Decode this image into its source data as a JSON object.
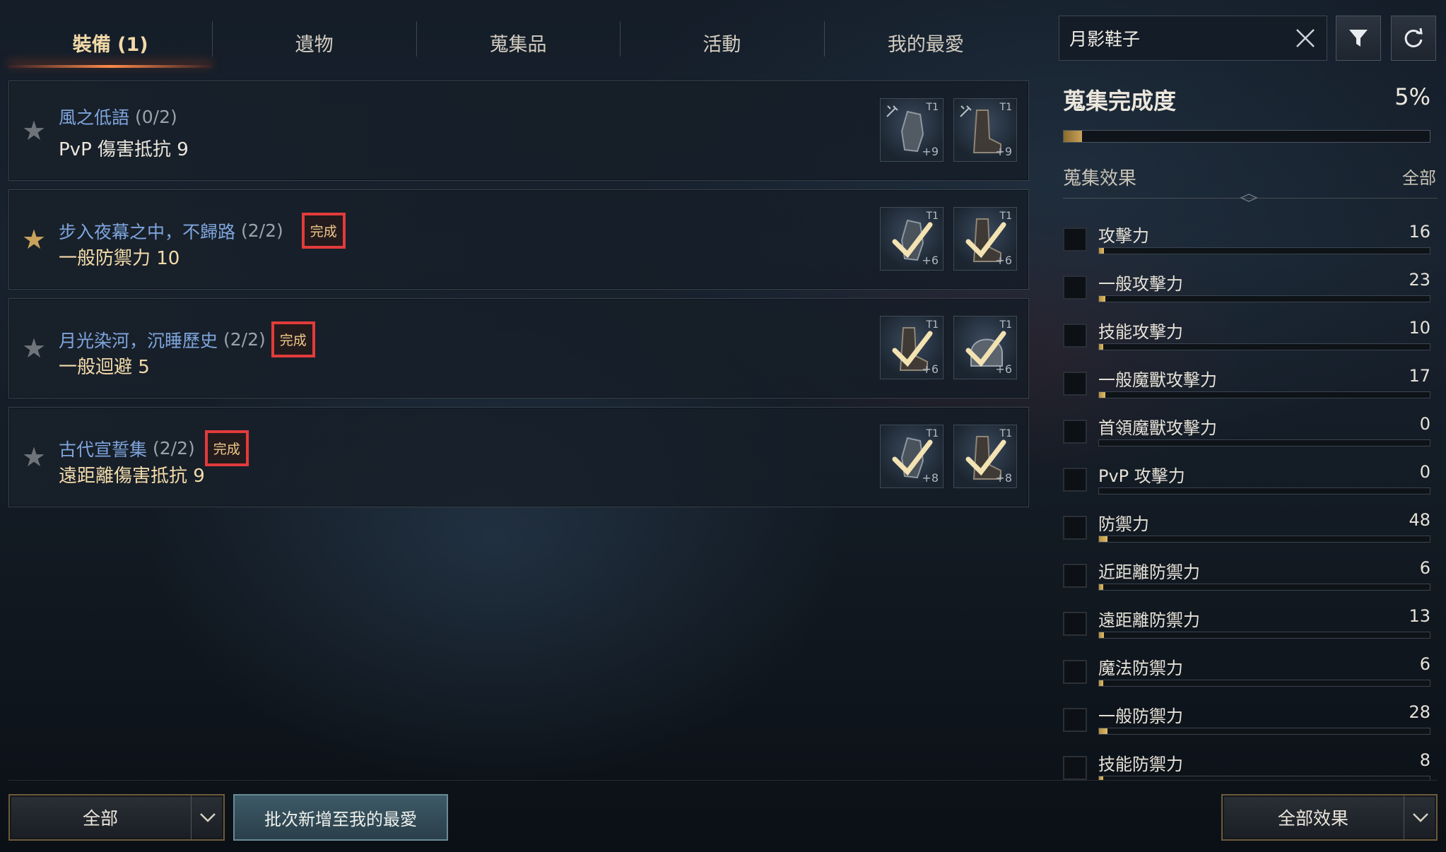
{
  "tabs": [
    {
      "label": "裝備 (1)"
    },
    {
      "label": "遺物"
    },
    {
      "label": "蒐集品"
    },
    {
      "label": "活動"
    },
    {
      "label": "我的最愛"
    }
  ],
  "search": {
    "value": "月影鞋子"
  },
  "collections": [
    {
      "name": "風之低語",
      "progress": "(0/2)",
      "stat": "PvP 傷害抵抗  9",
      "complete_label": "",
      "starred": false,
      "items": [
        {
          "tier": "T1",
          "enhance": "+9",
          "completed": false
        },
        {
          "tier": "T1",
          "enhance": "+9",
          "completed": false
        }
      ]
    },
    {
      "name": "步入夜幕之中，不歸路",
      "progress": "(2/2)",
      "stat": "一般防禦力  10",
      "complete_label": "完成",
      "starred": true,
      "items": [
        {
          "tier": "T1",
          "enhance": "+6",
          "completed": true
        },
        {
          "tier": "T1",
          "enhance": "+6",
          "completed": true
        }
      ]
    },
    {
      "name": "月光染河，沉睡歷史",
      "progress": "(2/2)",
      "stat": "一般迴避  5",
      "complete_label": "完成",
      "starred": false,
      "items": [
        {
          "tier": "T1",
          "enhance": "+6",
          "completed": true
        },
        {
          "tier": "T1",
          "enhance": "+6",
          "completed": true
        }
      ]
    },
    {
      "name": "古代宣誓集",
      "progress": "(2/2)",
      "stat": "遠距離傷害抵抗  9",
      "complete_label": "完成",
      "starred": false,
      "items": [
        {
          "tier": "T1",
          "enhance": "+8",
          "completed": true
        },
        {
          "tier": "T1",
          "enhance": "+8",
          "completed": true
        }
      ]
    }
  ],
  "summary": {
    "title": "蒐集完成度",
    "percent_label": "5%",
    "percent": 5
  },
  "effects": {
    "title": "蒐集效果",
    "all_label": "全部",
    "items": [
      {
        "name": "攻擊力",
        "value": "16",
        "fill": 0.016
      },
      {
        "name": "一般攻擊力",
        "value": "23",
        "fill": 0.02
      },
      {
        "name": "技能攻擊力",
        "value": "10",
        "fill": 0.01
      },
      {
        "name": "一般魔獸攻擊力",
        "value": "17",
        "fill": 0.02
      },
      {
        "name": "首領魔獸攻擊力",
        "value": "0",
        "fill": 0
      },
      {
        "name": "PvP 攻擊力",
        "value": "0",
        "fill": 0
      },
      {
        "name": "防禦力",
        "value": "48",
        "fill": 0.025
      },
      {
        "name": "近距離防禦力",
        "value": "6",
        "fill": 0.008
      },
      {
        "name": "遠距離防禦力",
        "value": "13",
        "fill": 0.015
      },
      {
        "name": "魔法防禦力",
        "value": "6",
        "fill": 0.008
      },
      {
        "name": "一般防禦力",
        "value": "28",
        "fill": 0.025
      },
      {
        "name": "技能防禦力",
        "value": "8",
        "fill": 0.01
      }
    ]
  },
  "bottom": {
    "filter_label": "全部",
    "batch_label": "批次新增至我的最愛",
    "effects_filter_label": "全部效果"
  },
  "colors": {
    "accent_gold": "#c9a25c",
    "complete_border": "#e23b3b",
    "set_name_blue": "#7fa5dd"
  }
}
